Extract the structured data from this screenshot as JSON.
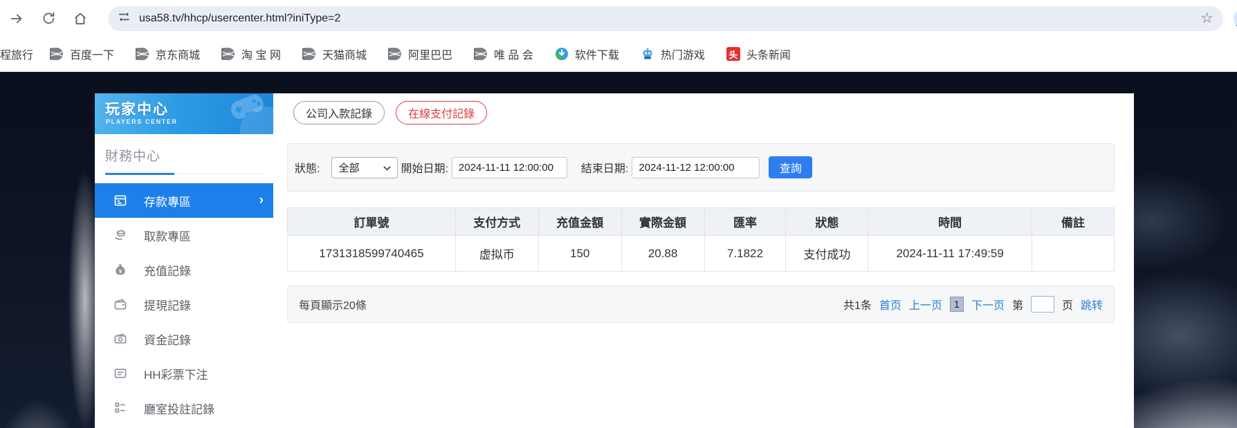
{
  "browser": {
    "url": "usa58.tv/hhcp/usercenter.html?iniType=2",
    "bookmarks": [
      {
        "label": "程旅行",
        "icon": "none"
      },
      {
        "label": "百度一下",
        "icon": "globe"
      },
      {
        "label": "京东商城",
        "icon": "globe"
      },
      {
        "label": "淘 宝 网",
        "icon": "globe"
      },
      {
        "label": "天猫商城",
        "icon": "globe"
      },
      {
        "label": "阿里巴巴",
        "icon": "globe"
      },
      {
        "label": "唯 品 会",
        "icon": "globe"
      },
      {
        "label": "软件下载",
        "icon": "software-download"
      },
      {
        "label": "热门游戏",
        "icon": "hot-games-robot"
      },
      {
        "label": "头条新闻",
        "icon": "toutiao",
        "badge_char": "头"
      }
    ]
  },
  "sidebar": {
    "title": "玩家中心",
    "subtitle": "PLAYERS CENTER",
    "section": "財務中心",
    "items": [
      {
        "label": "存款專區",
        "icon": "deposit-card-icon",
        "active": true
      },
      {
        "label": "取款專區",
        "icon": "withdraw-hand-icon",
        "active": false
      },
      {
        "label": "充值記錄",
        "icon": "moneybag-icon",
        "active": false
      },
      {
        "label": "提現記錄",
        "icon": "wallet-icon",
        "active": false
      },
      {
        "label": "資金記錄",
        "icon": "banknote-icon",
        "active": false
      },
      {
        "label": "HH彩票下注",
        "icon": "list-icon",
        "active": false
      },
      {
        "label": "廳室投註記錄",
        "icon": "checklist-icon",
        "active": false
      }
    ]
  },
  "tabs": [
    {
      "label": "公司入款記錄",
      "active": false
    },
    {
      "label": "在線支付記錄",
      "active": true
    }
  ],
  "filters": {
    "status_label": "狀態:",
    "status_value": "全部",
    "start_label": "開始日期:",
    "start_value": "2024-11-11 12:00:00",
    "end_label": "結束日期:",
    "end_value": "2024-11-12 12:00:00",
    "search_label": "查詢"
  },
  "table": {
    "headers": [
      "訂單號",
      "支付方式",
      "充值金額",
      "實際金額",
      "匯率",
      "狀態",
      "時間",
      "備註"
    ],
    "rows": [
      [
        "1731318599740465",
        "虚拟币",
        "150",
        "20.88",
        "7.1822",
        "支付成功",
        "2024-11-11 17:49:59",
        ""
      ]
    ]
  },
  "pagination": {
    "page_size_text": "每頁顯示20條",
    "total_text": "共1条",
    "first_label": "首页",
    "prev_label": "上一页",
    "current_page": "1",
    "next_label": "下一页",
    "page_prefix": "第",
    "page_suffix": "页",
    "jump_label": "跳转"
  },
  "colors": {
    "sidebar_active_blue": "#1d80e8",
    "banner_blue_start": "#55b5ee",
    "banner_blue_end": "#1b86dc",
    "search_button_blue": "#2e7ef0",
    "tab_active_red": "#dd3c3c",
    "link_blue": "#2b7fd4",
    "toutiao_red": "#e03131",
    "table_divider_pink": "#f0dede"
  }
}
